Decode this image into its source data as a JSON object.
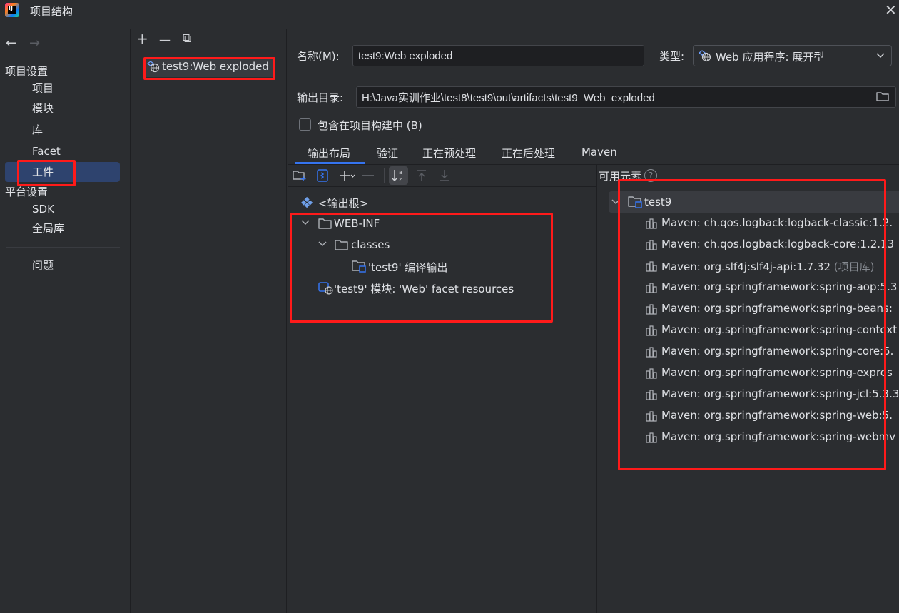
{
  "window": {
    "title": "项目结构",
    "close_glyph": "✕"
  },
  "nav": {
    "back_glyph": "←",
    "forward_glyph": "→",
    "project_settings_heading": "项目设置",
    "project_items": [
      "项目",
      "模块",
      "库",
      "Facet",
      "工件"
    ],
    "platform_settings_heading": "平台设置",
    "platform_items": [
      "SDK",
      "全局库"
    ],
    "problems": "问题",
    "selected": "工件"
  },
  "artifacts": {
    "toolbar": {
      "add": "+",
      "remove": "—",
      "copy": "⧉"
    },
    "items": [
      "test9:Web exploded"
    ]
  },
  "form": {
    "name_label": "名称(M):",
    "name_value": "test9:Web exploded",
    "type_label": "类型:",
    "type_value": "Web 应用程序: 展开型",
    "output_dir_label": "输出目录:",
    "output_dir_value": "H:\\Java实训作业\\test8\\test9\\out\\artifacts\\test9_Web_exploded",
    "include_in_build_label": "包含在项目构建中 (B)",
    "include_in_build_checked": false
  },
  "tabs": [
    "输出布局",
    "验证",
    "正在预处理",
    "正在后处理",
    "Maven"
  ],
  "active_tab": "输出布局",
  "layout_tree": {
    "root": "<输出根>",
    "web_inf": "WEB-INF",
    "classes": "classes",
    "compile_output": "'test9' 编译输出",
    "facet_resources": "'test9' 模块: 'Web' facet resources"
  },
  "available": {
    "heading": "可用元素",
    "help_glyph": "?",
    "module": "test9",
    "libraries": [
      {
        "name": "Maven: ch.qos.logback:logback-classic:1.2.",
        "suffix": ""
      },
      {
        "name": "Maven: ch.qos.logback:logback-core:1.2.13",
        "suffix": ""
      },
      {
        "name": "Maven: org.slf4j:slf4j-api:1.7.32",
        "suffix": "(项目库)"
      },
      {
        "name": "Maven: org.springframework:spring-aop:5.3",
        "suffix": ""
      },
      {
        "name": "Maven: org.springframework:spring-beans:",
        "suffix": ""
      },
      {
        "name": "Maven: org.springframework:spring-context",
        "suffix": ""
      },
      {
        "name": "Maven: org.springframework:spring-core:5.",
        "suffix": ""
      },
      {
        "name": "Maven: org.springframework:spring-expres",
        "suffix": ""
      },
      {
        "name": "Maven: org.springframework:spring-jcl:5.3.3",
        "suffix": ""
      },
      {
        "name": "Maven: org.springframework:spring-web:5.",
        "suffix": ""
      },
      {
        "name": "Maven: org.springframework:spring-webmv",
        "suffix": ""
      }
    ]
  },
  "colors": {
    "accent": "#3574f0",
    "selection": "#2e436e",
    "highlight_box": "#ff1a1a",
    "background": "#2b2d30"
  }
}
